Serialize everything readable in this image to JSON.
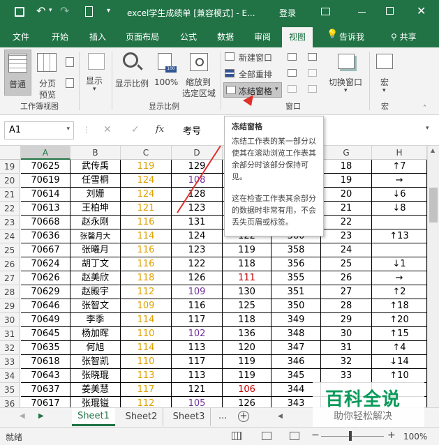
{
  "titlebar": {
    "title": "excel学生成绩单 [兼容模式] - E...",
    "login": "登录",
    "qat": {
      "save": "save-icon",
      "undo": "undo-icon",
      "redo": "redo-icon",
      "new": "new-file-icon",
      "more": "▾"
    }
  },
  "tabs": [
    {
      "label": "文件"
    },
    {
      "label": "开始"
    },
    {
      "label": "插入"
    },
    {
      "label": "页面布局"
    },
    {
      "label": "公式"
    },
    {
      "label": "数据"
    },
    {
      "label": "审阅"
    },
    {
      "label": "视图"
    }
  ],
  "tell_me": "告诉我",
  "share": "共享",
  "ribbon": {
    "normal": "普通",
    "page_break_1": "分页",
    "page_break_2": "预览",
    "group_workbook_views": "工作簿视图",
    "show": "显示",
    "zoom": "显示比例",
    "zoom100": "100%",
    "zoom_sel_1": "缩放到",
    "zoom_sel_2": "选定区域",
    "group_zoom": "显示比例",
    "new_window": "新建窗口",
    "arrange_all": "全部重排",
    "freeze": "冻结窗格",
    "group_window": "窗口",
    "switch_window": "切换窗口",
    "macro": "宏",
    "group_macro": "宏"
  },
  "formula_bar": {
    "name_box": "A1",
    "fx": "fx",
    "content": "考号"
  },
  "tooltip": {
    "title": "冻结窗格",
    "p1": "冻结工作表的某一部分以使其在滚动浏览工作表其余部分时该部分保持可见。",
    "p2": "这在检查工作表其余部分的数据时非常有用，不会丢失页眉或标签。"
  },
  "columns": [
    "A",
    "B",
    "C",
    "D",
    "E",
    "F",
    "G",
    "H"
  ],
  "rows": [
    {
      "n": "19",
      "a": "70625",
      "b": "武传禹",
      "c": "119",
      "d": "129",
      "e": "",
      "f": "",
      "g": "18",
      "h": "↑7"
    },
    {
      "n": "20",
      "a": "70619",
      "b": "任雪桐",
      "c": "124",
      "d": "108",
      "e": "",
      "f": "",
      "g": "19",
      "h": "→"
    },
    {
      "n": "21",
      "a": "70614",
      "b": "刘姗",
      "c": "124",
      "d": "128",
      "e": "",
      "f": "",
      "g": "20",
      "h": "↓6"
    },
    {
      "n": "22",
      "a": "70613",
      "b": "王柏坤",
      "c": "121",
      "d": "123",
      "e": "",
      "f": "",
      "g": "21",
      "h": "↓8"
    },
    {
      "n": "23",
      "a": "70668",
      "b": "赵永刚",
      "c": "116",
      "d": "131",
      "e": "",
      "f": "",
      "g": "22",
      "h": ""
    },
    {
      "n": "24",
      "a": "70636",
      "b": "张馨月大",
      "c": "114",
      "d": "124",
      "e": "122",
      "f": "360",
      "g": "23",
      "h": "↑13"
    },
    {
      "n": "25",
      "a": "70667",
      "b": "张曦月",
      "c": "116",
      "d": "123",
      "e": "119",
      "f": "358",
      "g": "24",
      "h": ""
    },
    {
      "n": "26",
      "a": "70624",
      "b": "胡丁文",
      "c": "116",
      "d": "122",
      "e": "118",
      "f": "356",
      "g": "25",
      "h": "↓1"
    },
    {
      "n": "27",
      "a": "70626",
      "b": "赵美欣",
      "c": "118",
      "d": "126",
      "e": "111",
      "f": "355",
      "g": "26",
      "h": "→"
    },
    {
      "n": "28",
      "a": "70629",
      "b": "赵殿宇",
      "c": "112",
      "d": "109",
      "e": "130",
      "f": "351",
      "g": "27",
      "h": "↑2"
    },
    {
      "n": "29",
      "a": "70646",
      "b": "张智文",
      "c": "109",
      "d": "116",
      "e": "125",
      "f": "350",
      "g": "28",
      "h": "↑18"
    },
    {
      "n": "30",
      "a": "70649",
      "b": "李季",
      "c": "114",
      "d": "117",
      "e": "118",
      "f": "349",
      "g": "29",
      "h": "↑20"
    },
    {
      "n": "31",
      "a": "70645",
      "b": "杨加晖",
      "c": "110",
      "d": "102",
      "e": "136",
      "f": "348",
      "g": "30",
      "h": "↑15"
    },
    {
      "n": "32",
      "a": "70635",
      "b": "何旭",
      "c": "114",
      "d": "113",
      "e": "120",
      "f": "347",
      "g": "31",
      "h": "↑4"
    },
    {
      "n": "33",
      "a": "70618",
      "b": "张智凯",
      "c": "110",
      "d": "117",
      "e": "119",
      "f": "346",
      "g": "32",
      "h": "↓14"
    },
    {
      "n": "34",
      "a": "70643",
      "b": "张晓琨",
      "c": "113",
      "d": "113",
      "e": "119",
      "f": "345",
      "g": "33",
      "h": "↑10"
    },
    {
      "n": "35",
      "a": "70637",
      "b": "姜美慧",
      "c": "117",
      "d": "121",
      "e": "106",
      "f": "344",
      "g": "",
      "h": ""
    },
    {
      "n": "36",
      "a": "70617",
      "b": "张琨镒",
      "c": "112",
      "d": "105",
      "e": "126",
      "f": "343",
      "g": "",
      "h": ""
    }
  ],
  "sheets": [
    "Sheet1",
    "Sheet2",
    "Sheet3",
    "..."
  ],
  "status": {
    "ready": "就绪",
    "zoom": "100%"
  },
  "watermark": {
    "main": "百科全说",
    "sub": "助你轻松解决"
  },
  "colors": {
    "green": "#217346",
    "orange": "#e0a000",
    "purple": "#7030a0",
    "red": "#c00000"
  }
}
